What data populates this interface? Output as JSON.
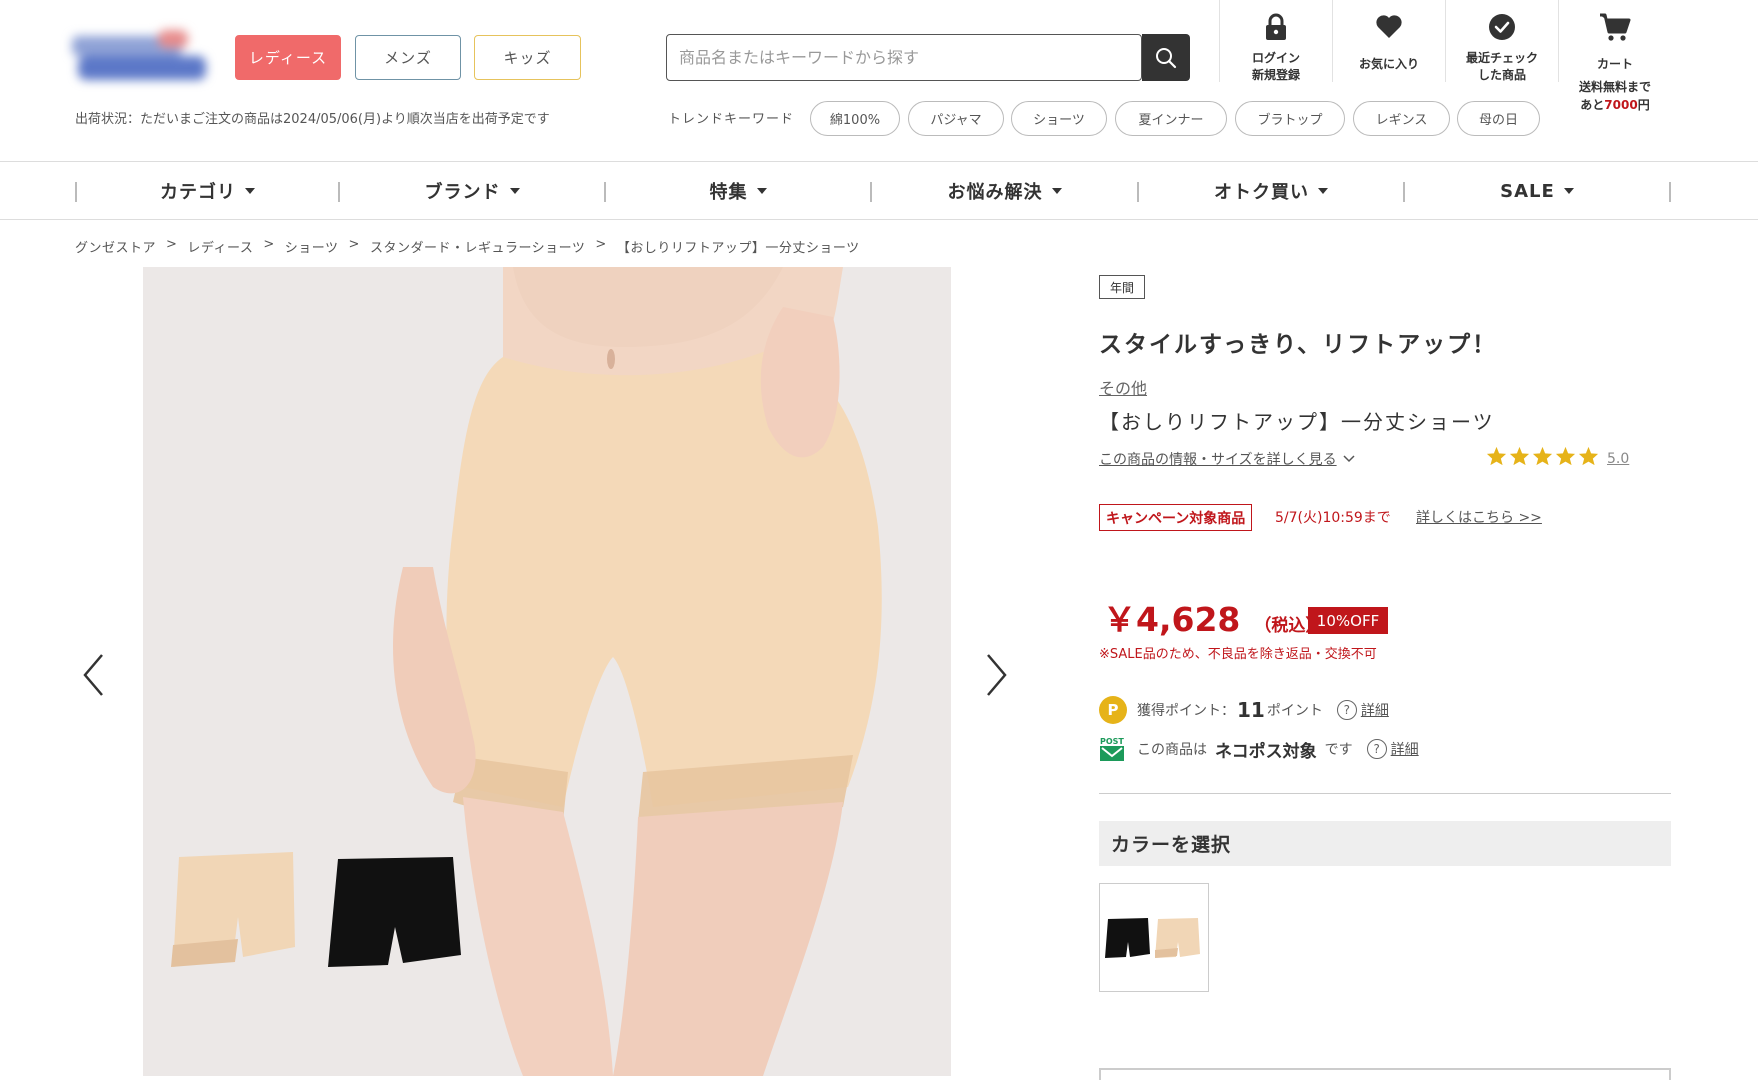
{
  "header": {
    "gender_tabs": [
      "レディース",
      "メンズ",
      "キッズ"
    ],
    "shipping_status": "出荷状況：ただいまご注文の商品は2024/05/06(月)より順次当店を出荷予定です",
    "search": {
      "placeholder": "商品名またはキーワードから探す",
      "value": ""
    },
    "trend_label": "トレンドキーワード",
    "trend_keywords": [
      "綿100%",
      "パジャマ",
      "ショーツ",
      "夏インナー",
      "ブラトップ",
      "レギンス",
      "母の日"
    ],
    "icons": [
      {
        "name": "login-icon",
        "label_line1": "ログイン",
        "label_line2": "新規登録"
      },
      {
        "name": "heart-icon",
        "label_line1": "お気に入り",
        "label_line2": ""
      },
      {
        "name": "check-circle-icon",
        "label_line1": "最近チェック",
        "label_line2": "した商品"
      },
      {
        "name": "cart-icon",
        "label_line1": "カート",
        "label_line2": ""
      }
    ],
    "cart_note_line1": "送料無料まで",
    "cart_note_prefix": "あと",
    "cart_note_amount": "7000",
    "cart_note_suffix": "円"
  },
  "nav": {
    "items": [
      "カテゴリ",
      "ブランド",
      "特集",
      "お悩み解決",
      "オトク買い",
      "SALE"
    ]
  },
  "breadcrumb": [
    "グンゼストア",
    "レディース",
    "ショーツ",
    "スタンダード・レギュラーショーツ",
    "【おしりリフトアップ】一分丈ショーツ"
  ],
  "product": {
    "season_tag": "年間",
    "catchphrase": "スタイルすっきり、リフトアップ！",
    "brand": "その他",
    "name": "【おしりリフトアップ】一分丈ショーツ",
    "info_link": "この商品の情報・サイズを詳しく見る",
    "rating": "5.0",
    "rating_stars": 5,
    "campaign_badge": "キャンペーン対象商品",
    "campaign_deadline": "5/7(火)10:59まで",
    "campaign_more": "詳しくはこちら >>",
    "price": "￥4,628",
    "tax_label": "（税込）",
    "discount": "10%OFF",
    "sale_note": "※SALE品のため、不良品を除き返品・交換不可",
    "points_label": "獲得ポイント：",
    "points_value": "11",
    "points_unit": "ポイント",
    "detail_label": "詳細",
    "nekopos_prefix": "この商品は",
    "nekopos_strong": "ネコポス対象",
    "nekopos_suffix": "です",
    "color_header": "カラーを選択",
    "p_icon_letter": "P",
    "post_icon_text": "POST"
  },
  "colors": {
    "price_red": "#c0161b",
    "ladies": "#f06a6a",
    "mens_border": "#6f93a6",
    "kids_border": "#e6c35c",
    "star": "#e6b319",
    "beige": "#f4d9b8",
    "image_bg": "#ece8e7"
  }
}
